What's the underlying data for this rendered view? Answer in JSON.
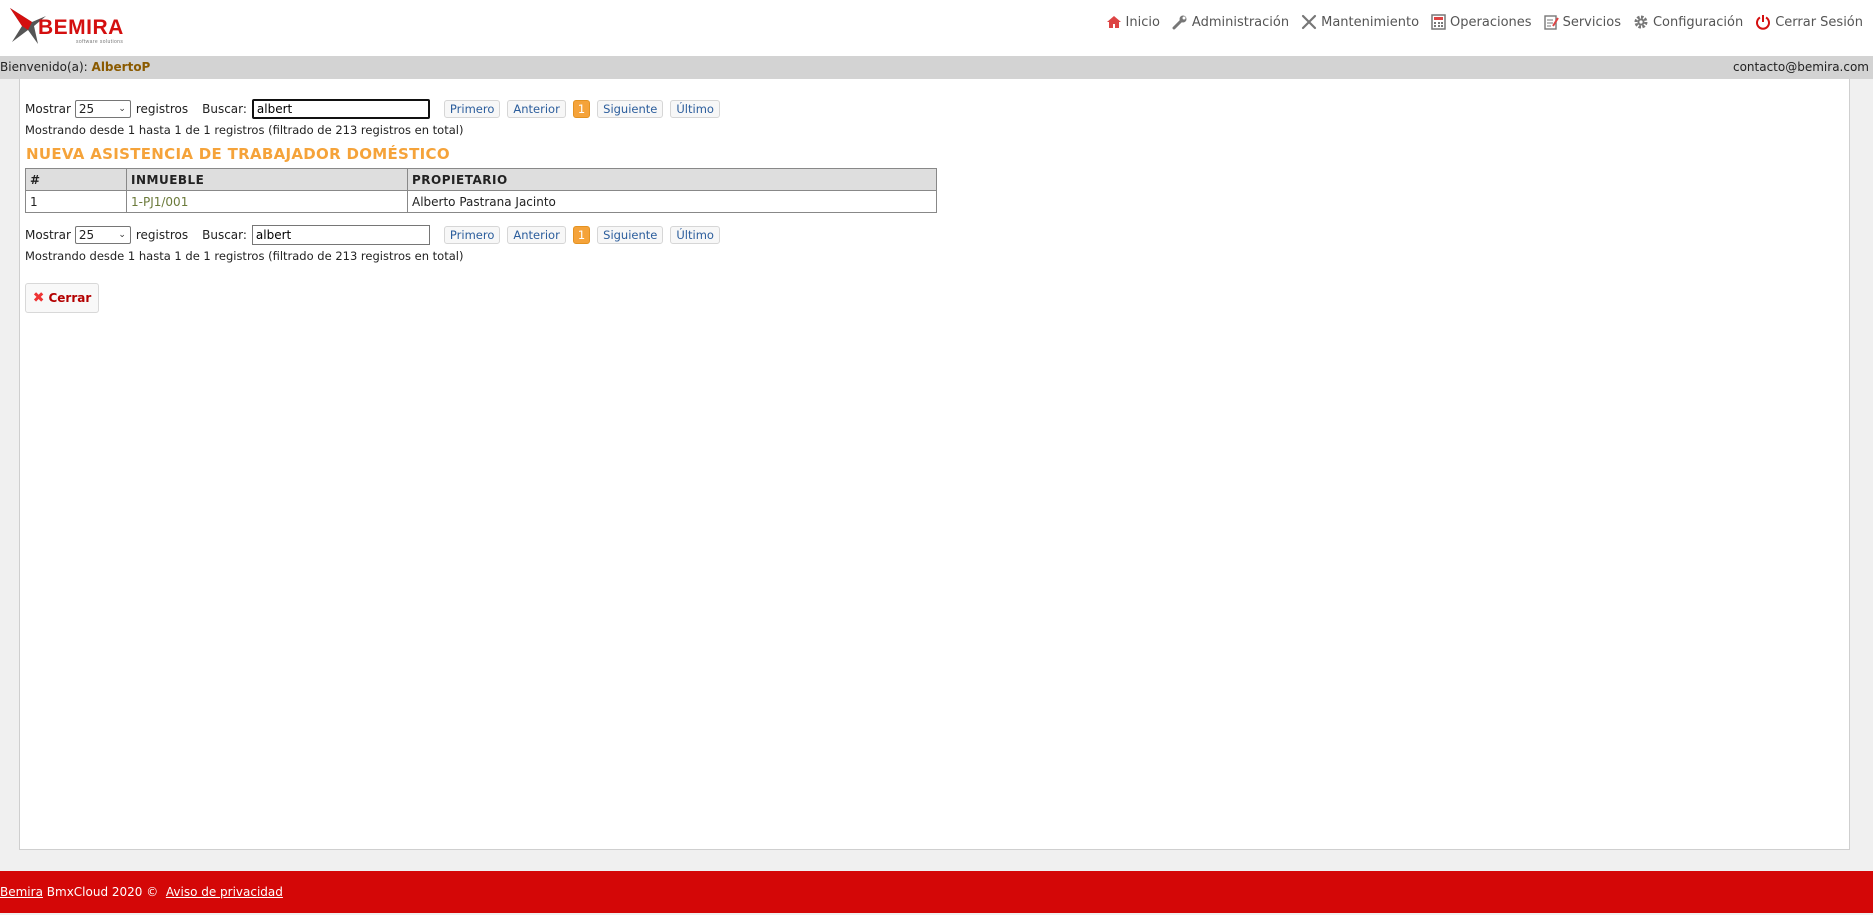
{
  "header": {
    "logo_text": "BEMIRA",
    "logo_sub": "software solutions",
    "nav": [
      {
        "label": "Inicio",
        "icon": "home-icon"
      },
      {
        "label": "Administración",
        "icon": "wrench-icon"
      },
      {
        "label": "Mantenimiento",
        "icon": "tools-icon"
      },
      {
        "label": "Operaciones",
        "icon": "calculator-icon"
      },
      {
        "label": "Servicios",
        "icon": "notepad-icon"
      },
      {
        "label": "Configuración",
        "icon": "gear-icon"
      },
      {
        "label": "Cerrar Sesión",
        "icon": "power-icon"
      }
    ]
  },
  "welcome": {
    "label": "Bienvenido(a):",
    "user": "AlbertoP",
    "contact": "contacto@bemira.com"
  },
  "controls_top": {
    "show_label": "Mostrar",
    "page_size": "25",
    "records_label": "registros",
    "search_label": "Buscar:",
    "search_value": "albert",
    "pager": {
      "first": "Primero",
      "prev": "Anterior",
      "current": "1",
      "next": "Siguiente",
      "last": "Último"
    },
    "info": "Mostrando desde 1 hasta 1 de 1 registros (filtrado de 213 registros en total)"
  },
  "page_title": "NUEVA ASISTENCIA DE TRABAJADOR DOMÉSTICO",
  "table": {
    "headers": [
      "#",
      "INMUEBLE",
      "PROPIETARIO"
    ],
    "rows": [
      {
        "num": "1",
        "inmueble": "1-PJ1/001",
        "propietario": "Alberto Pastrana Jacinto"
      }
    ]
  },
  "controls_bottom": {
    "show_label": "Mostrar",
    "page_size": "25",
    "records_label": "registros",
    "search_label": "Buscar:",
    "search_value": "albert",
    "pager": {
      "first": "Primero",
      "prev": "Anterior",
      "current": "1",
      "next": "Siguiente",
      "last": "Último"
    },
    "info": "Mostrando desde 1 hasta 1 de 1 registros (filtrado de 213 registros en total)"
  },
  "close_button": "Cerrar",
  "footer": {
    "brand": "Bemira",
    "text": "BmxCloud 2020 ©",
    "privacy": "Aviso de privacidad"
  },
  "colors": {
    "brand_red": "#d40707",
    "accent_orange": "#f5a33a",
    "welcome_bar": "#d3d3d3"
  }
}
